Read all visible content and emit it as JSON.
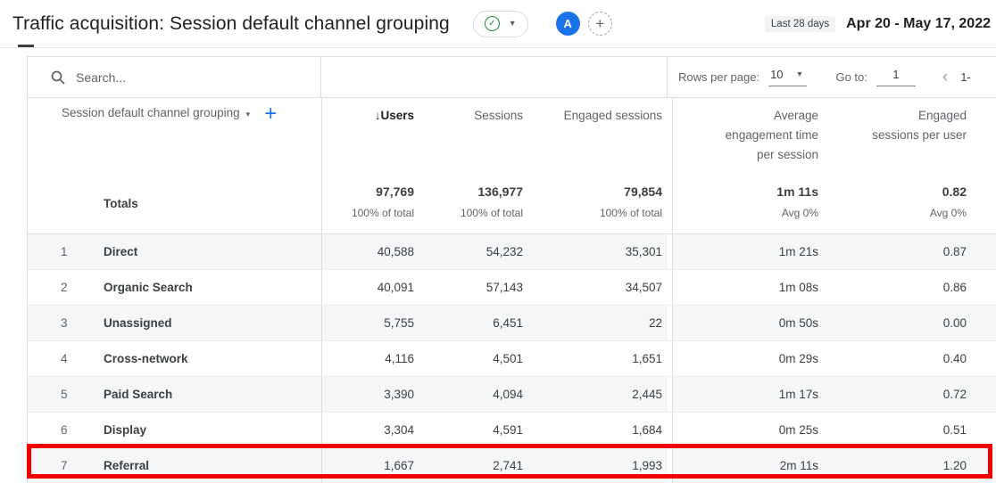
{
  "header": {
    "title": "Traffic acquisition: Session default channel grouping",
    "avatar_letter": "A",
    "date_range_label": "Last 28 days",
    "date_range": "Apr 20 - May 17, 2022",
    "colors": {
      "avatar_bg": "#1a73e8",
      "verified_green": "#1e8e3e",
      "accent_blue": "#1a73e8"
    }
  },
  "toolbar": {
    "search_placeholder": "Search...",
    "rows_per_page_label": "Rows per page:",
    "rows_per_page_value": "10",
    "go_to_label": "Go to:",
    "go_to_value": "1",
    "pagination_range": "1-",
    "chevron_left": "‹"
  },
  "table": {
    "dimension_header": "Session default channel grouping",
    "metric_headers": {
      "users": "Users",
      "sessions": "Sessions",
      "engaged_sessions": "Engaged sessions",
      "avg_engagement_time": "Average engagement time per session",
      "engaged_sessions_per_user": "Engaged sessions per user"
    },
    "totals": {
      "label": "Totals",
      "users": "97,769",
      "users_sub": "100% of total",
      "sessions": "136,977",
      "sessions_sub": "100% of total",
      "engaged_sessions": "79,854",
      "engaged_sub": "100% of total",
      "avg_engagement_time": "1m 11s",
      "avg_sub": "Avg 0%",
      "engaged_sessions_per_user": "0.82",
      "espu_sub": "Avg 0%"
    },
    "rows": [
      {
        "num": "1",
        "channel": "Direct",
        "users": "40,588",
        "sessions": "54,232",
        "engaged_sessions": "35,301",
        "avg_engagement_time": "1m 21s",
        "engaged_sessions_per_user": "0.87"
      },
      {
        "num": "2",
        "channel": "Organic Search",
        "users": "40,091",
        "sessions": "57,143",
        "engaged_sessions": "34,507",
        "avg_engagement_time": "1m 08s",
        "engaged_sessions_per_user": "0.86"
      },
      {
        "num": "3",
        "channel": "Unassigned",
        "users": "5,755",
        "sessions": "6,451",
        "engaged_sessions": "22",
        "avg_engagement_time": "0m 50s",
        "engaged_sessions_per_user": "0.00"
      },
      {
        "num": "4",
        "channel": "Cross-network",
        "users": "4,116",
        "sessions": "4,501",
        "engaged_sessions": "1,651",
        "avg_engagement_time": "0m 29s",
        "engaged_sessions_per_user": "0.40"
      },
      {
        "num": "5",
        "channel": "Paid Search",
        "users": "3,390",
        "sessions": "4,094",
        "engaged_sessions": "2,445",
        "avg_engagement_time": "1m 17s",
        "engaged_sessions_per_user": "0.72"
      },
      {
        "num": "6",
        "channel": "Display",
        "users": "3,304",
        "sessions": "4,591",
        "engaged_sessions": "1,684",
        "avg_engagement_time": "0m 25s",
        "engaged_sessions_per_user": "0.51"
      },
      {
        "num": "7",
        "channel": "Referral",
        "users": "1,667",
        "sessions": "2,741",
        "engaged_sessions": "1,993",
        "avg_engagement_time": "2m 11s",
        "engaged_sessions_per_user": "1.20"
      }
    ],
    "highlight": {
      "highlighted_row": "7",
      "color": "#f10000"
    }
  }
}
